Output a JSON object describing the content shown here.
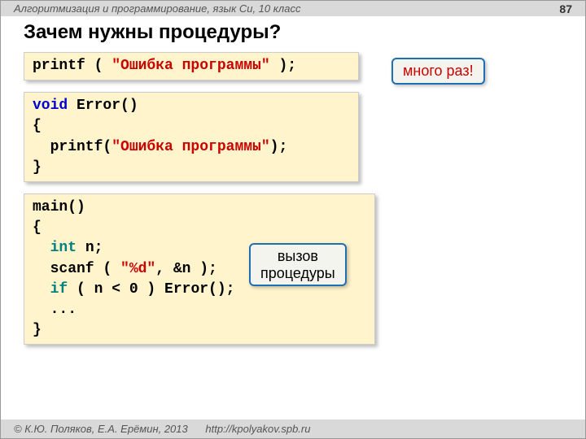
{
  "header": {
    "course": "Алгоритмизация и программирование, язык Си, 10 класс",
    "page_number": "87"
  },
  "title": "Зачем нужны процедуры?",
  "code1": {
    "printf": "printf",
    "open": " ( ",
    "str": "\"Ошибка программы\"",
    "close": " );"
  },
  "bubble1": "много раз!",
  "code2": {
    "kw_void": "void",
    "name": " Error()",
    "lbrace": "{",
    "indent_printf": "  printf(",
    "str": "\"Ошибка программы\"",
    "endcall": ");",
    "rbrace": "}"
  },
  "code3": {
    "main": "main()",
    "lbrace": "{",
    "kw_int": "  int",
    "var": " n;",
    "scanf": "  scanf ( ",
    "fmt": "\"%d\"",
    "scanf_end": ", &n );",
    "kw_if": "  if",
    "cond": " ( n < 0 ) Error();",
    "dots": "  ...",
    "rbrace": "}"
  },
  "bubble2_l1": "вызов",
  "bubble2_l2": "процедуры",
  "footer": {
    "copyright": "© К.Ю. Поляков, Е.А. Ерёмин, 2013",
    "url": "http://kpolyakov.spb.ru"
  }
}
